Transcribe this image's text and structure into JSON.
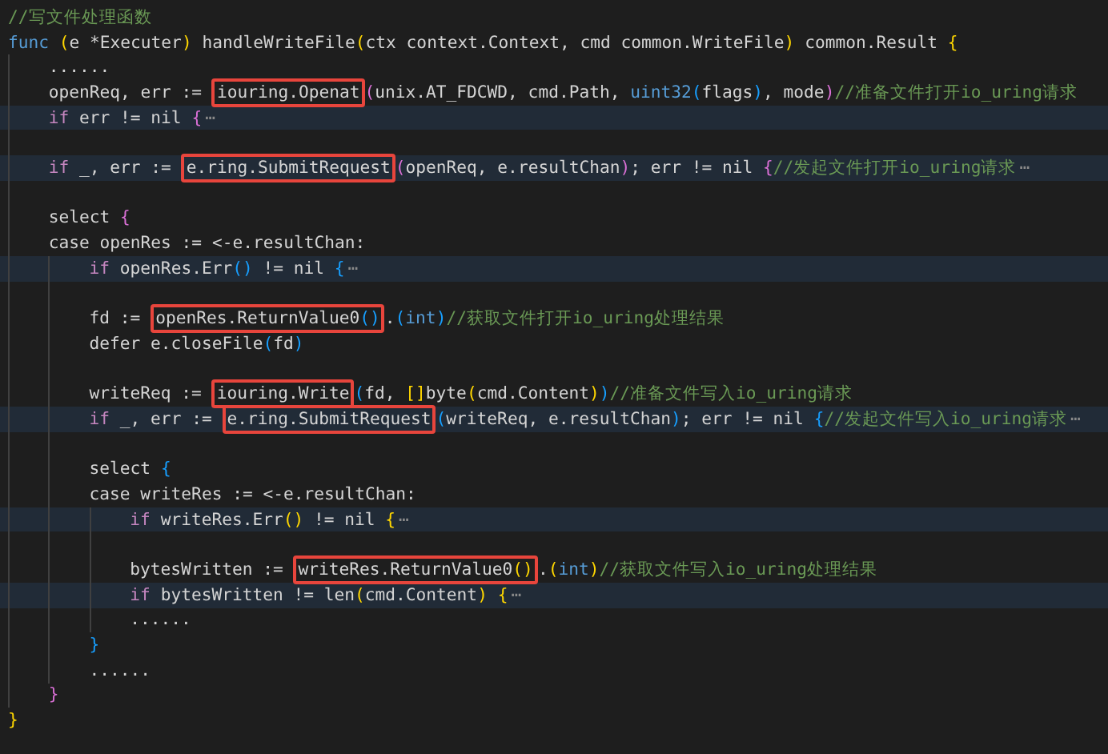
{
  "editor": {
    "lines": [
      {
        "kind": "code",
        "folded": false,
        "tokens": [
          {
            "kind": "comment",
            "text": "//写文件处理函数"
          }
        ]
      },
      {
        "kind": "code",
        "folded": false,
        "tokens": [
          {
            "kind": "func-keyword",
            "text": "func "
          },
          {
            "kind": "bracket-1",
            "text": "("
          },
          {
            "kind": "plain",
            "text": "e *Executer"
          },
          {
            "kind": "bracket-1",
            "text": ")"
          },
          {
            "kind": "plain",
            "text": " handleWriteFile"
          },
          {
            "kind": "bracket-1",
            "text": "("
          },
          {
            "kind": "plain",
            "text": "ctx context.Context, cmd common.WriteFile"
          },
          {
            "kind": "bracket-1",
            "text": ")"
          },
          {
            "kind": "plain",
            "text": " common.Result "
          },
          {
            "kind": "bracket-1",
            "text": "{"
          }
        ],
        "children": [
          {
            "kind": "code",
            "folded": false,
            "tokens": [
              {
                "kind": "plain",
                "text": "......"
              }
            ]
          },
          {
            "kind": "code",
            "folded": false,
            "tokens": [
              {
                "kind": "plain",
                "text": "openReq, err := "
              },
              {
                "kind": "box",
                "tokens": [
                  {
                    "kind": "plain",
                    "text": "iouring.Openat"
                  }
                ]
              },
              {
                "kind": "bracket-2",
                "text": "("
              },
              {
                "kind": "plain",
                "text": "unix.AT_FDCWD, cmd.Path, "
              },
              {
                "kind": "type",
                "text": "uint32"
              },
              {
                "kind": "bracket-3",
                "text": "("
              },
              {
                "kind": "plain",
                "text": "flags"
              },
              {
                "kind": "bracket-3",
                "text": ")"
              },
              {
                "kind": "plain",
                "text": ", mode"
              },
              {
                "kind": "bracket-2",
                "text": ")"
              },
              {
                "kind": "comment",
                "text": "//准备文件打开io_uring请求"
              }
            ]
          },
          {
            "kind": "code",
            "folded": true,
            "tokens": [
              {
                "kind": "keyword",
                "text": "if"
              },
              {
                "kind": "plain",
                "text": " err != nil "
              },
              {
                "kind": "bracket-2",
                "text": "{"
              },
              {
                "kind": "fold",
                "text": "⋯"
              }
            ]
          },
          {
            "kind": "blank"
          },
          {
            "kind": "code",
            "folded": true,
            "tokens": [
              {
                "kind": "keyword",
                "text": "if"
              },
              {
                "kind": "plain",
                "text": " _, err := "
              },
              {
                "kind": "box",
                "tokens": [
                  {
                    "kind": "plain",
                    "text": "e.ring.SubmitRequest"
                  }
                ]
              },
              {
                "kind": "bracket-2",
                "text": "("
              },
              {
                "kind": "plain",
                "text": "openReq, e.resultChan"
              },
              {
                "kind": "bracket-2",
                "text": ")"
              },
              {
                "kind": "plain",
                "text": "; err != nil "
              },
              {
                "kind": "bracket-2",
                "text": "{"
              },
              {
                "kind": "comment",
                "text": "//发起文件打开io_uring请求"
              },
              {
                "kind": "fold",
                "text": "⋯"
              }
            ]
          },
          {
            "kind": "blank"
          },
          {
            "kind": "code",
            "folded": false,
            "tokens": [
              {
                "kind": "plain",
                "text": "select "
              },
              {
                "kind": "bracket-2",
                "text": "{"
              }
            ]
          },
          {
            "kind": "code",
            "folded": false,
            "tokens": [
              {
                "kind": "plain",
                "text": "case openRes := <-e.resultChan:"
              }
            ],
            "children": [
              {
                "kind": "code",
                "folded": true,
                "tokens": [
                  {
                    "kind": "keyword",
                    "text": "if"
                  },
                  {
                    "kind": "plain",
                    "text": " openRes.Err"
                  },
                  {
                    "kind": "bracket-3",
                    "text": "()"
                  },
                  {
                    "kind": "plain",
                    "text": " != nil "
                  },
                  {
                    "kind": "bracket-3",
                    "text": "{"
                  },
                  {
                    "kind": "fold",
                    "text": "⋯"
                  }
                ]
              },
              {
                "kind": "blank"
              },
              {
                "kind": "code",
                "folded": false,
                "tokens": [
                  {
                    "kind": "plain",
                    "text": "fd := "
                  },
                  {
                    "kind": "box",
                    "tokens": [
                      {
                        "kind": "plain",
                        "text": "openRes.ReturnValue0"
                      },
                      {
                        "kind": "bracket-3",
                        "text": "()"
                      }
                    ]
                  },
                  {
                    "kind": "plain",
                    "text": "."
                  },
                  {
                    "kind": "bracket-3",
                    "text": "("
                  },
                  {
                    "kind": "type",
                    "text": "int"
                  },
                  {
                    "kind": "bracket-3",
                    "text": ")"
                  },
                  {
                    "kind": "comment",
                    "text": "//获取文件打开io_uring处理结果"
                  }
                ]
              },
              {
                "kind": "code",
                "folded": false,
                "tokens": [
                  {
                    "kind": "plain",
                    "text": "defer e.closeFile"
                  },
                  {
                    "kind": "bracket-3",
                    "text": "("
                  },
                  {
                    "kind": "plain",
                    "text": "fd"
                  },
                  {
                    "kind": "bracket-3",
                    "text": ")"
                  }
                ]
              },
              {
                "kind": "blank"
              },
              {
                "kind": "code",
                "folded": false,
                "tokens": [
                  {
                    "kind": "plain",
                    "text": "writeReq := "
                  },
                  {
                    "kind": "box",
                    "tokens": [
                      {
                        "kind": "plain",
                        "text": "iouring.Write"
                      }
                    ]
                  },
                  {
                    "kind": "bracket-3",
                    "text": "("
                  },
                  {
                    "kind": "plain",
                    "text": "fd, "
                  },
                  {
                    "kind": "bracket-1",
                    "text": "[]"
                  },
                  {
                    "kind": "plain",
                    "text": "byte"
                  },
                  {
                    "kind": "bracket-1",
                    "text": "("
                  },
                  {
                    "kind": "plain",
                    "text": "cmd.Content"
                  },
                  {
                    "kind": "bracket-1",
                    "text": ")"
                  },
                  {
                    "kind": "bracket-3",
                    "text": ")"
                  },
                  {
                    "kind": "comment",
                    "text": "//准备文件写入io_uring请求"
                  }
                ]
              },
              {
                "kind": "code",
                "folded": true,
                "tokens": [
                  {
                    "kind": "keyword",
                    "text": "if"
                  },
                  {
                    "kind": "plain",
                    "text": " _, err := "
                  },
                  {
                    "kind": "box",
                    "tokens": [
                      {
                        "kind": "plain",
                        "text": "e.ring.SubmitRequest"
                      }
                    ]
                  },
                  {
                    "kind": "bracket-3",
                    "text": "("
                  },
                  {
                    "kind": "plain",
                    "text": "writeReq, e.resultChan"
                  },
                  {
                    "kind": "bracket-3",
                    "text": ")"
                  },
                  {
                    "kind": "plain",
                    "text": "; err != nil "
                  },
                  {
                    "kind": "bracket-3",
                    "text": "{"
                  },
                  {
                    "kind": "comment",
                    "text": "//发起文件写入io_uring请求"
                  },
                  {
                    "kind": "fold",
                    "text": "⋯"
                  }
                ]
              },
              {
                "kind": "blank"
              },
              {
                "kind": "code",
                "folded": false,
                "tokens": [
                  {
                    "kind": "plain",
                    "text": "select "
                  },
                  {
                    "kind": "bracket-3",
                    "text": "{"
                  }
                ]
              },
              {
                "kind": "code",
                "folded": false,
                "tokens": [
                  {
                    "kind": "plain",
                    "text": "case writeRes := <-e.resultChan:"
                  }
                ],
                "children": [
                  {
                    "kind": "code",
                    "folded": true,
                    "tokens": [
                      {
                        "kind": "keyword",
                        "text": "if"
                      },
                      {
                        "kind": "plain",
                        "text": " writeRes.Err"
                      },
                      {
                        "kind": "bracket-1",
                        "text": "()"
                      },
                      {
                        "kind": "plain",
                        "text": " != nil "
                      },
                      {
                        "kind": "bracket-1",
                        "text": "{"
                      },
                      {
                        "kind": "fold",
                        "text": "⋯"
                      }
                    ]
                  },
                  {
                    "kind": "blank"
                  },
                  {
                    "kind": "code",
                    "folded": false,
                    "tokens": [
                      {
                        "kind": "plain",
                        "text": "bytesWritten := "
                      },
                      {
                        "kind": "box",
                        "tokens": [
                          {
                            "kind": "plain",
                            "text": "writeRes.ReturnValue0"
                          },
                          {
                            "kind": "bracket-1",
                            "text": "()"
                          }
                        ]
                      },
                      {
                        "kind": "plain",
                        "text": "."
                      },
                      {
                        "kind": "bracket-1",
                        "text": "("
                      },
                      {
                        "kind": "type",
                        "text": "int"
                      },
                      {
                        "kind": "bracket-1",
                        "text": ")"
                      },
                      {
                        "kind": "comment",
                        "text": "//获取文件写入io_uring处理结果"
                      }
                    ]
                  },
                  {
                    "kind": "code",
                    "folded": true,
                    "tokens": [
                      {
                        "kind": "keyword",
                        "text": "if"
                      },
                      {
                        "kind": "plain",
                        "text": " bytesWritten != len"
                      },
                      {
                        "kind": "bracket-1",
                        "text": "("
                      },
                      {
                        "kind": "plain",
                        "text": "cmd.Content"
                      },
                      {
                        "kind": "bracket-1",
                        "text": ") "
                      },
                      {
                        "kind": "bracket-1",
                        "text": "{"
                      },
                      {
                        "kind": "fold",
                        "text": "⋯"
                      }
                    ]
                  },
                  {
                    "kind": "code",
                    "folded": false,
                    "tokens": [
                      {
                        "kind": "plain",
                        "text": "......"
                      }
                    ]
                  }
                ]
              },
              {
                "kind": "code",
                "folded": false,
                "tokens": [
                  {
                    "kind": "bracket-3",
                    "text": "}"
                  }
                ]
              },
              {
                "kind": "code",
                "folded": false,
                "tokens": [
                  {
                    "kind": "plain",
                    "text": "......"
                  }
                ]
              }
            ]
          },
          {
            "kind": "code",
            "folded": false,
            "tokens": [
              {
                "kind": "bracket-2",
                "text": "}"
              }
            ]
          }
        ]
      },
      {
        "kind": "code",
        "folded": false,
        "tokens": [
          {
            "kind": "bracket-1",
            "text": "}"
          }
        ]
      }
    ]
  }
}
